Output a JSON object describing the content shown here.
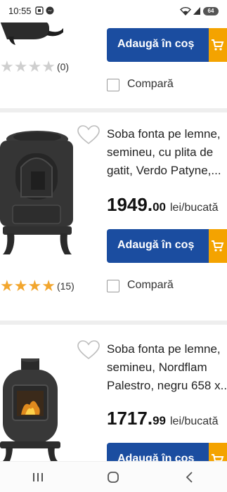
{
  "status_bar": {
    "time": "10:55",
    "battery": "64"
  },
  "cards": [
    {
      "add_label": "Adaugă în coș",
      "compare_label": "Compară",
      "rating_count": "(0)"
    },
    {
      "title_lines": [
        "Soba fonta pe lemne,",
        "semineu, cu plita de",
        "gatit, Verdo Patyne,..."
      ],
      "price_int": "1949.",
      "price_cents": "00",
      "price_unit": "lei/bucată",
      "add_label": "Adaugă în coș",
      "compare_label": "Compară",
      "rating_count": "(15)"
    },
    {
      "title_lines": [
        "Soba fonta pe lemne,",
        "semineu, Nordflam",
        "Palestro, negru 658 x..."
      ],
      "price_int": "1717.",
      "price_cents": "99",
      "price_unit": "lei/bucată",
      "add_label": "Adaugă în coș"
    }
  ],
  "icons": {
    "wishlist": "heart-outline-icon",
    "cart": "cart-icon",
    "nav": [
      "recents-icon",
      "home-icon",
      "back-icon"
    ]
  },
  "colors": {
    "add_button": "#1b4da0",
    "cart_accent": "#f4a300",
    "star_full": "#f2a62e",
    "star_empty": "#cfcfcf"
  }
}
